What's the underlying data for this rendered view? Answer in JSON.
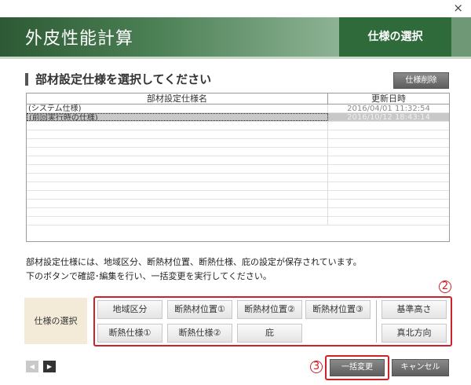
{
  "window": {
    "close_glyph": "×"
  },
  "header": {
    "app_title": "外皮性能計算",
    "tab_label": "仕様の選択"
  },
  "section": {
    "title": "部材設定仕様を選択してください",
    "delete_button": "仕様削除"
  },
  "grid": {
    "columns": [
      "部材設定仕様名",
      "更新日時"
    ],
    "rows": [
      {
        "name": "(システム仕様)",
        "updated": "2016/04/01 11:32:54",
        "selected": false
      },
      {
        "name": "(前回実行時の仕様)",
        "updated": "2016/10/12 18:43:14",
        "selected": true
      }
    ]
  },
  "description": {
    "line1": "部材設定仕様には、地域区分、断熱材位置、断熱仕様、庇の設定が保存されています。",
    "line2": "下のボタンで確認･編集を行い、一括変更を実行してください。"
  },
  "spec_panel": {
    "label": "仕様の選択",
    "buttons": {
      "region": "地域区分",
      "insulation_pos1": "断熱材位置①",
      "insulation_pos2": "断熱材位置②",
      "insulation_pos3": "断熱材位置③",
      "insulation_spec1": "断熱仕様①",
      "insulation_spec2": "断熱仕様②",
      "eaves": "庇",
      "base_height": "基準高さ",
      "true_north": "真北方向"
    }
  },
  "annotations": {
    "two": "2",
    "three": "3"
  },
  "footer": {
    "prev_glyph": "◀",
    "next_glyph": "▶",
    "bulk_change": "一括変更",
    "cancel": "キャンセル"
  },
  "colors": {
    "header_green": "#2f6b3a",
    "annotation_red": "#d0212a",
    "selected_row": "#c8c8c8"
  },
  "icons": {
    "close": "close-icon",
    "prev": "triangle-left-icon",
    "next": "triangle-right-icon"
  }
}
